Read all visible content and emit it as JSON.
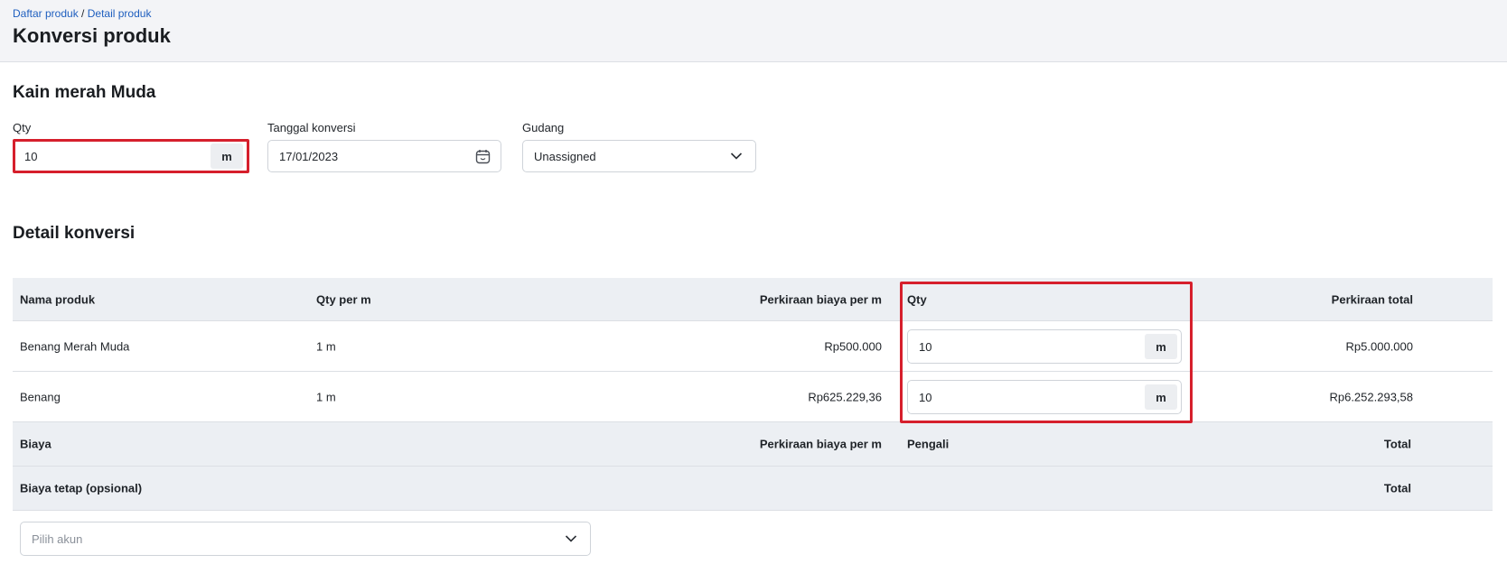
{
  "breadcrumb": {
    "item1": "Daftar produk",
    "separator": "/",
    "item2": "Detail produk"
  },
  "page_title": "Konversi produk",
  "product": {
    "name": "Kain merah Muda",
    "qty_label": "Qty",
    "qty_value": "10",
    "qty_unit": "m",
    "date_label": "Tanggal konversi",
    "date_value": "17/01/2023",
    "warehouse_label": "Gudang",
    "warehouse_value": "Unassigned"
  },
  "detail": {
    "title": "Detail konversi",
    "headers": {
      "name": "Nama produk",
      "qty_per": "Qty per m",
      "cost_per": "Perkiraan biaya per m",
      "qty": "Qty",
      "total": "Perkiraan total"
    },
    "rows": [
      {
        "name": "Benang Merah Muda",
        "qty_per": "1 m",
        "cost_per": "Rp500.000",
        "qty": "10",
        "unit": "m",
        "total": "Rp5.000.000"
      },
      {
        "name": "Benang",
        "qty_per": "1 m",
        "cost_per": "Rp625.229,36",
        "qty": "10",
        "unit": "m",
        "total": "Rp6.252.293,58"
      }
    ],
    "cost_headers": {
      "name": "Biaya",
      "cost_per": "Perkiraan biaya per m",
      "multiplier": "Pengali",
      "total": "Total"
    },
    "fixed_headers": {
      "name": "Biaya tetap (opsional)",
      "total": "Total"
    },
    "account_placeholder": "Pilih akun"
  },
  "colors": {
    "highlight": "#d61f2c",
    "link": "#1f5fbf"
  },
  "icons": {
    "calendar": "calendar-icon",
    "chevron": "chevron-down-icon"
  }
}
